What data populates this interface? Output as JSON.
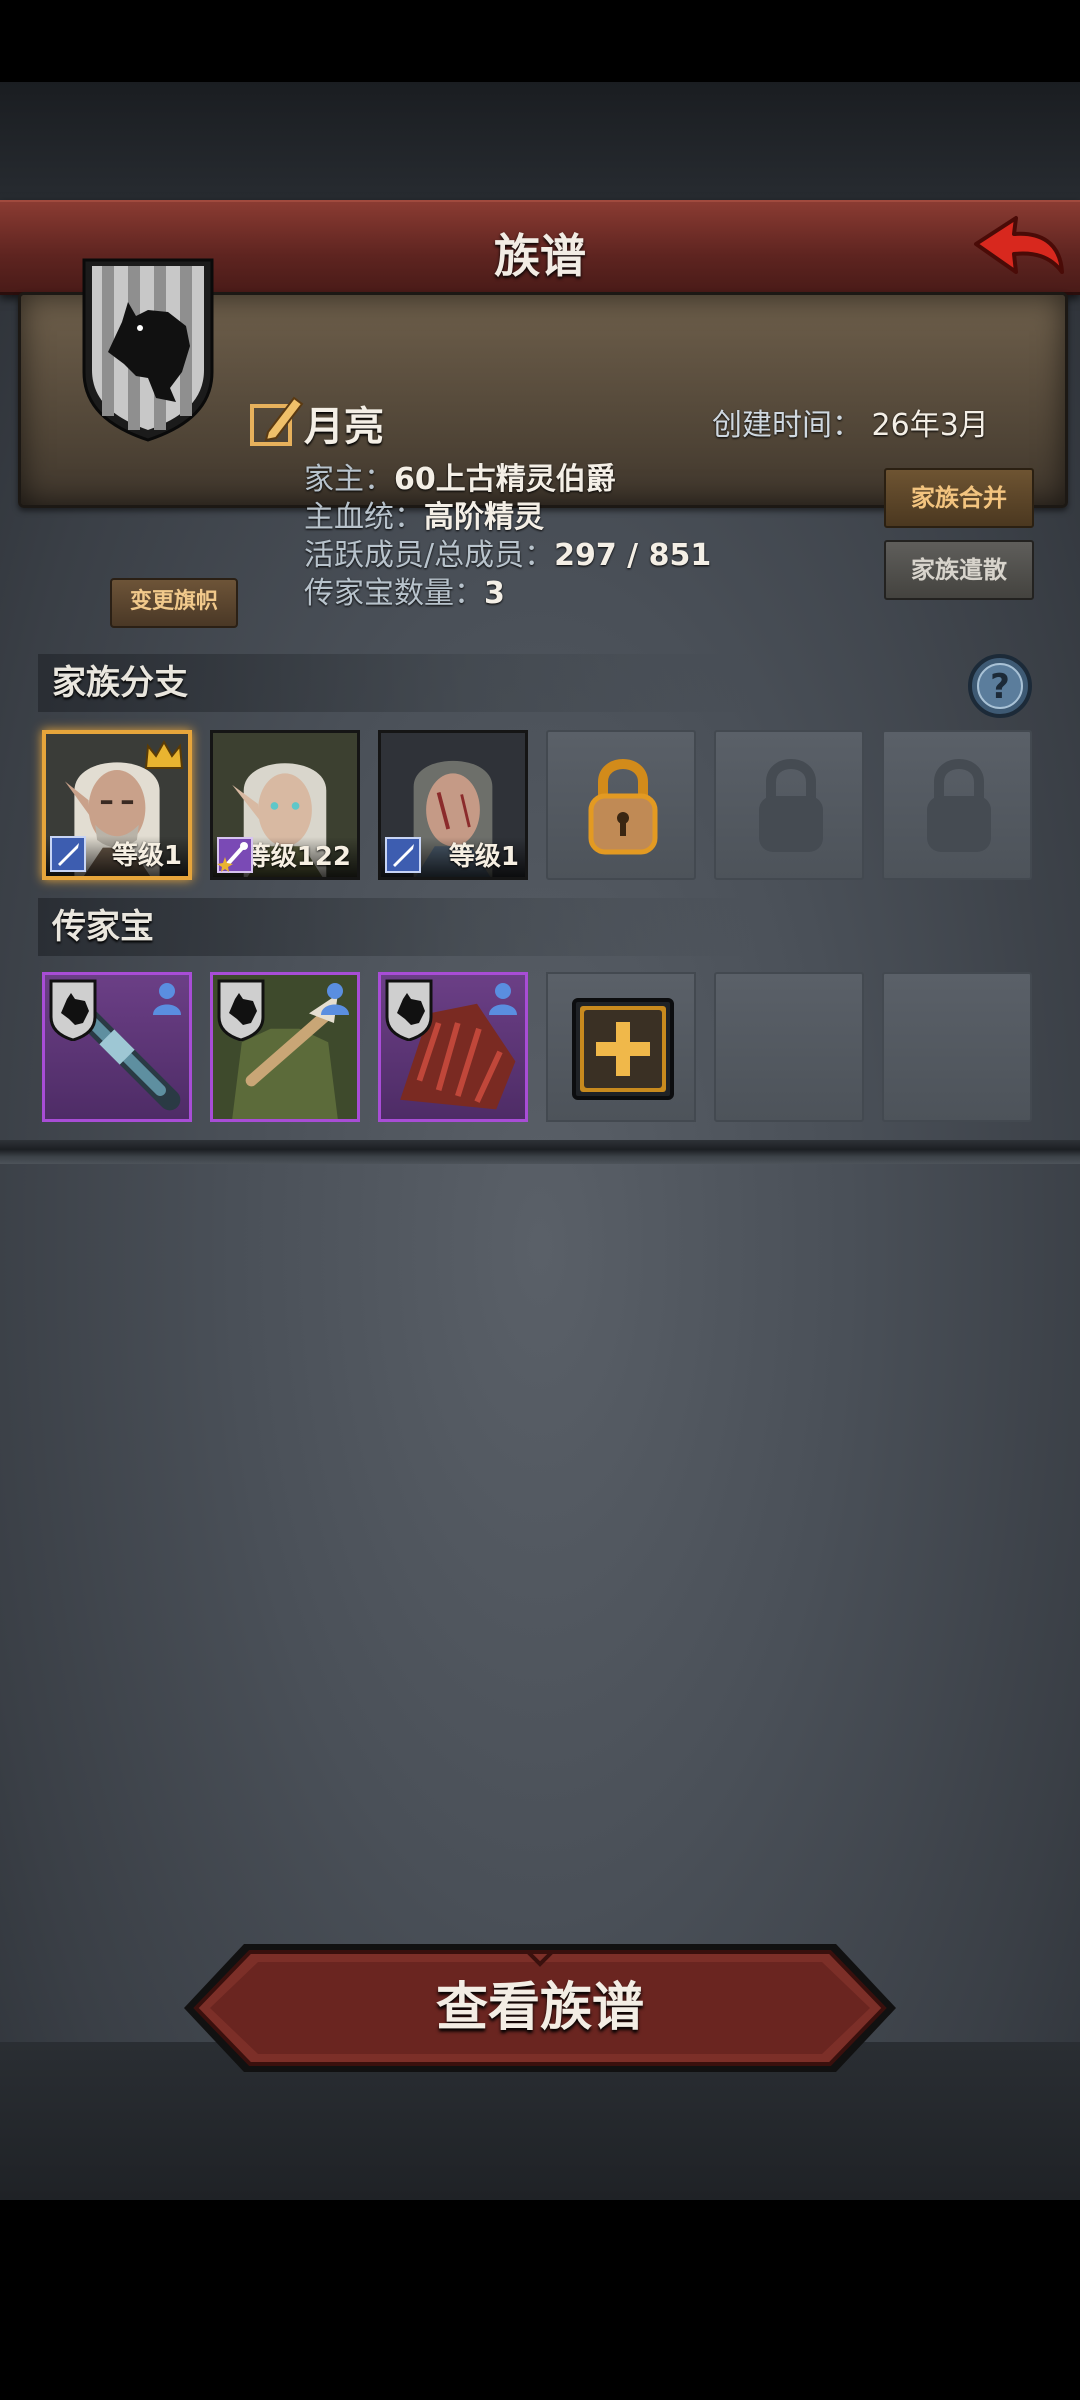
{
  "header": {
    "title": "族谱"
  },
  "family": {
    "name": "月亮",
    "change_banner_label": "变更旗帜",
    "created_label": "创建时间：",
    "created_value": "26年3月",
    "leader_label": "家主：",
    "leader_value": "60上古精灵伯爵",
    "bloodline_label": "主血统：",
    "bloodline_value": "高阶精灵",
    "members_label": "活跃成员/总成员：",
    "members_value": "297 / 851",
    "heirloom_count_label": "传家宝数量：",
    "heirloom_count_value": "3",
    "merge_label": "家族合并",
    "disband_label": "家族遣散"
  },
  "branches": {
    "title": "家族分支",
    "items": [
      {
        "level": "等级1",
        "class": "sword",
        "crown": true,
        "selected": true
      },
      {
        "level": "等级122",
        "class": "staff",
        "crown": false,
        "selected": false
      },
      {
        "level": "等级1",
        "class": "sword",
        "crown": false,
        "selected": false
      }
    ],
    "locked_slots": 3
  },
  "heirlooms": {
    "title": "传家宝",
    "items": [
      {
        "name": "weapon-club",
        "rarity_color": "#a84dd6"
      },
      {
        "name": "armor-torso",
        "rarity_color": "#a84dd6"
      },
      {
        "name": "gauntlet-red",
        "rarity_color": "#a84dd6"
      }
    ],
    "empty_slots": 2
  },
  "footer": {
    "view_button_label": "查看族谱"
  },
  "colors": {
    "accent_red": "#6e2a25",
    "gold": "#e6a53b",
    "purple": "#a84dd6"
  }
}
